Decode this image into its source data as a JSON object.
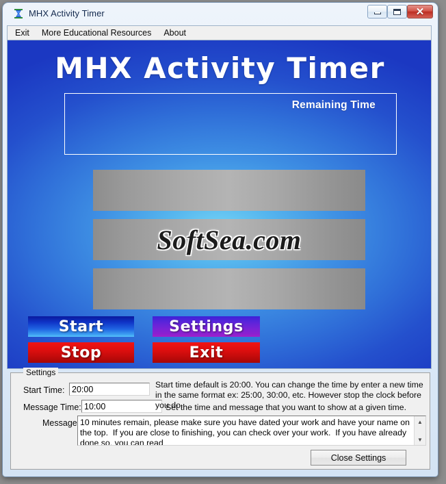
{
  "window": {
    "title": "MHX Activity Timer",
    "icon": "hourglass-icon",
    "controls": {
      "minimize": "minimize-icon",
      "maximize": "maximize-icon",
      "close": "✕"
    }
  },
  "menu": {
    "items": [
      {
        "label": "Exit"
      },
      {
        "label": "More Educational Resources"
      },
      {
        "label": "About"
      }
    ]
  },
  "app": {
    "heading": "MHX Activity Timer",
    "remaining_label": "Remaining Time",
    "remaining_value": "",
    "watermark": "SoftSea.com",
    "panels": [
      "",
      "",
      ""
    ],
    "buttons": {
      "start": "Start",
      "settings": "Settings",
      "stop": "Stop",
      "exit": "Exit"
    }
  },
  "settings": {
    "legend": "Settings",
    "start_time_label": "Start Time:",
    "start_time_value": "20:00",
    "message_time_label": "Message Time:",
    "message_time_value": "10:00",
    "message_label": "Message",
    "message_value": "10 minutes remain, please make sure you have dated your work and have your name on the top.  If you are close to finishing, you can check over your work.  If you have already done so, you can read",
    "helper_start_time": "Start time default is 20:00. You can change the time by enter a new time in the same format ex: 25:00, 30:00, etc. However stop the clock before you do.",
    "helper_message_time": "Set the time and message that you want to show at a given time.",
    "close_button": "Close Settings",
    "scroll_up": "▲",
    "scroll_down": "▼"
  },
  "colors": {
    "accent_blue": "#2f6ed8",
    "canvas_center": "#74d3f5",
    "canvas_edge": "#1b38c2",
    "start_button": "#1f63e2",
    "settings_button": "#7a23d6",
    "stop_button": "#e00f0f",
    "exit_button": "#e00f0f",
    "panel_gray": "#b4b4b4",
    "close_button_red": "#bb2e22"
  }
}
